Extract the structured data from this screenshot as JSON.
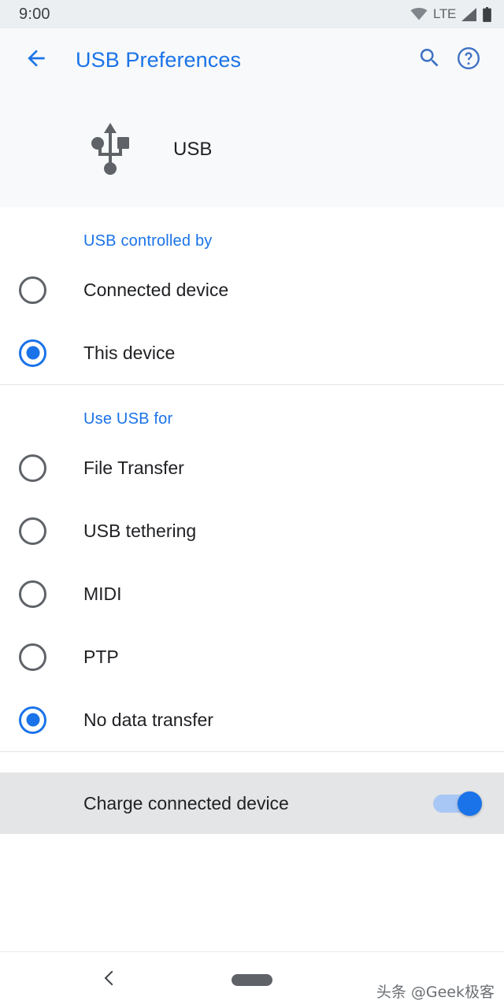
{
  "status_bar": {
    "time": "9:00",
    "network_label": "LTE",
    "icons": [
      "wifi-icon",
      "signal-icon",
      "battery-icon"
    ]
  },
  "app_bar": {
    "back_icon": "arrow-back-icon",
    "title": "USB Preferences",
    "search_icon": "search-icon",
    "help_icon": "help-circle-icon",
    "accent_color": "#1a73e8"
  },
  "usb_header": {
    "icon": "usb-icon",
    "label": "USB"
  },
  "sections": [
    {
      "title": "USB controlled by",
      "options": [
        {
          "label": "Connected device",
          "selected": false
        },
        {
          "label": "This device",
          "selected": true
        }
      ]
    },
    {
      "title": "Use USB for",
      "options": [
        {
          "label": "File Transfer",
          "selected": false
        },
        {
          "label": "USB tethering",
          "selected": false
        },
        {
          "label": "MIDI",
          "selected": false
        },
        {
          "label": "PTP",
          "selected": false
        },
        {
          "label": "No data transfer",
          "selected": true
        }
      ]
    }
  ],
  "charge_toggle": {
    "label": "Charge connected device",
    "state": "on",
    "track_color": "#a9c7f5",
    "thumb_color": "#1a73e8"
  },
  "nav_bar": {
    "back_icon": "chevron-left-icon",
    "home_pill": "home-gesture-pill"
  },
  "watermark": {
    "text": "头条 @Geek极客"
  }
}
